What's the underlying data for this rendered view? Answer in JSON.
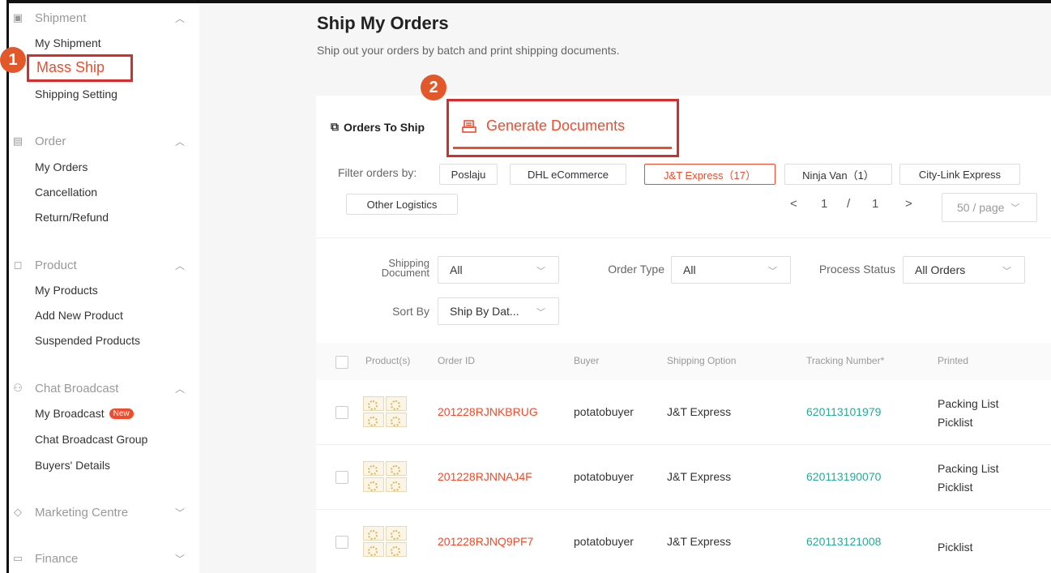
{
  "sidebar": {
    "shipment": {
      "title": "Shipment",
      "items": [
        "My Shipment",
        "Mass Ship",
        "Shipping Setting"
      ]
    },
    "order": {
      "title": "Order",
      "items": [
        "My Orders",
        "Cancellation",
        "Return/Refund"
      ]
    },
    "product": {
      "title": "Product",
      "items": [
        "My Products",
        "Add New Product",
        "Suspended Products"
      ]
    },
    "chat": {
      "title": "Chat Broadcast",
      "items": [
        "My Broadcast",
        "Chat Broadcast Group",
        "Buyers' Details"
      ],
      "new_badge": "New"
    },
    "marketing": {
      "title": "Marketing Centre"
    },
    "finance": {
      "title": "Finance"
    }
  },
  "markers": {
    "one": "1",
    "two": "2"
  },
  "page": {
    "title": "Ship My Orders",
    "subtitle": "Ship out your orders by batch and print shipping documents."
  },
  "tabs": {
    "orders_to_ship": "Orders To Ship",
    "generate_documents": "Generate Documents"
  },
  "filter": {
    "label": "Filter orders by:",
    "chips": [
      "Poslaju",
      "DHL eCommerce",
      "J&T Express（17）",
      "Ninja Van（1）",
      "City-Link Express",
      "Other Logistics"
    ],
    "active_color": "#ee4d2d"
  },
  "pagination": {
    "prev": "<",
    "current": "1",
    "sep": "/",
    "total": "1",
    "next": ">",
    "page_size": "50 / page"
  },
  "filters": {
    "shipping_document_label_1": "Shipping",
    "shipping_document_label_2": "Document",
    "shipping_document_value": "All",
    "order_type_label": "Order Type",
    "order_type_value": "All",
    "process_status_label": "Process Status",
    "process_status_value": "All Orders",
    "sort_by_label": "Sort By",
    "sort_by_value": "Ship By Dat..."
  },
  "table": {
    "headers": [
      "Product(s)",
      "Order ID",
      "Buyer",
      "Shipping Option",
      "Tracking Number*",
      "Printed"
    ],
    "rows": [
      {
        "order_id": "201228RJNKBRUG",
        "buyer": "potatobuyer",
        "shipping": "J&T Express",
        "tracking": "620113101979",
        "printed": [
          "Packing List",
          "Picklist"
        ]
      },
      {
        "order_id": "201228RJNNAJ4F",
        "buyer": "potatobuyer",
        "shipping": "J&T Express",
        "tracking": "620113190070",
        "printed": [
          "Packing List",
          "Picklist"
        ]
      },
      {
        "order_id": "201228RJNQ9PF7",
        "buyer": "potatobuyer",
        "shipping": "J&T Express",
        "tracking": "620113121008",
        "printed": [
          "Picklist"
        ]
      }
    ]
  },
  "colors": {
    "brand": "#ee4d2d",
    "highlight_box": "#d72c2c",
    "tracking": "#26aa99",
    "marker": "#e2582a"
  }
}
